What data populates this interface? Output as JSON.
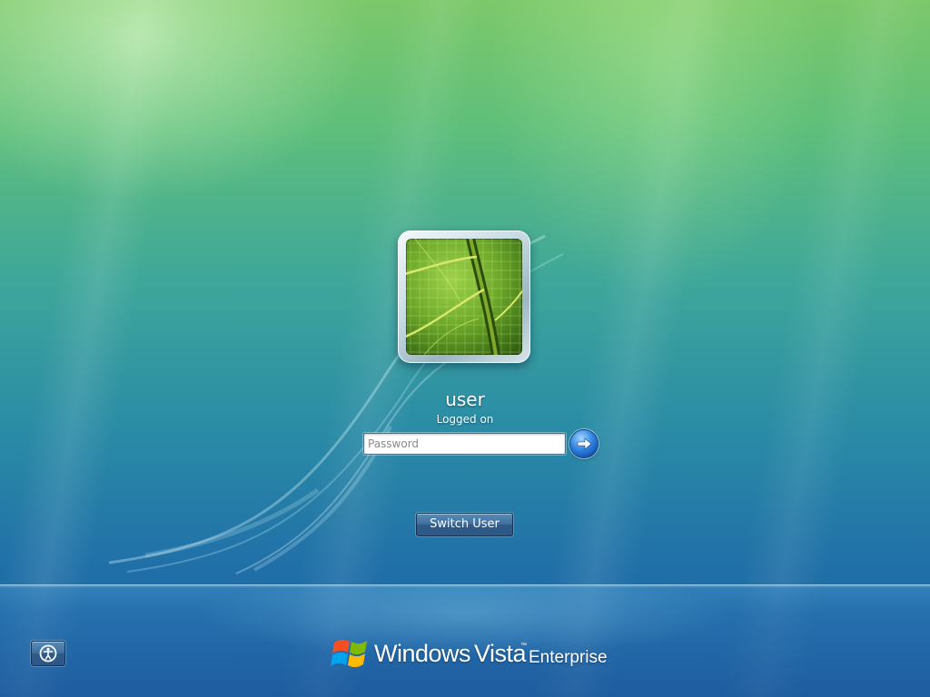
{
  "login": {
    "user_name": "user",
    "status": "Logged on",
    "password_placeholder": "Password",
    "password_value": "",
    "switch_user_label": "Switch User"
  },
  "icons": {
    "go": "right-arrow-icon",
    "ease_of_access": "ease-of-access-icon",
    "windows_logo": "windows-flag-icon",
    "user_picture": "leaf-picture"
  },
  "branding": {
    "windows": "Windows",
    "vista": "Vista",
    "trademark": "™",
    "edition": "Enterprise"
  },
  "colors": {
    "background_top": "#7cc86a",
    "background_bottom": "#1d5f9e",
    "button_blue": "#3f6f9e",
    "go_button_blue": "#1557b8"
  }
}
